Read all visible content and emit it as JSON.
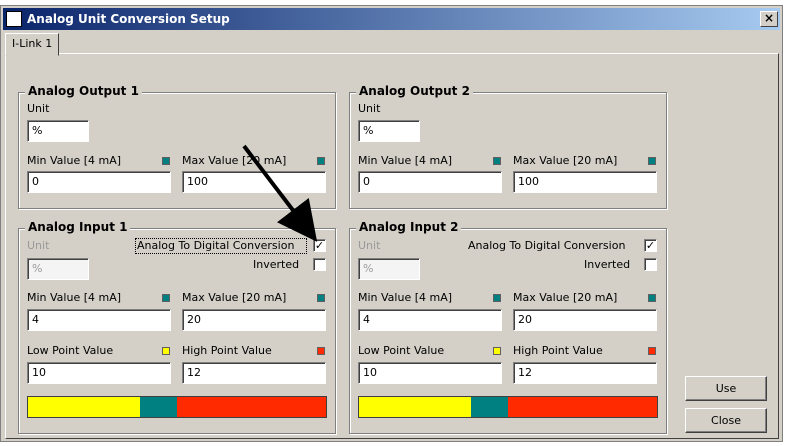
{
  "window": {
    "title": "Analog Unit Conversion Setup",
    "close_glyph": "×"
  },
  "tabs": [
    {
      "label": "I-Link 1"
    }
  ],
  "colors": {
    "low_led": "#ffff00",
    "mid_led": "#008080",
    "high_led": "#ff2a00",
    "title_gradient_start": "#0a246a"
  },
  "outputs": [
    {
      "title": "Analog Output 1",
      "unit_label": "Unit",
      "unit_value": "%",
      "min_label": "Min Value [4 mA]",
      "min_value": "0",
      "max_label": "Max Value [20 mA]",
      "max_value": "100"
    },
    {
      "title": "Analog Output 2",
      "unit_label": "Unit",
      "unit_value": "%",
      "min_label": "Min Value [4 mA]",
      "min_value": "0",
      "max_label": "Max Value [20 mA]",
      "max_value": "100"
    }
  ],
  "inputs": [
    {
      "title": "Analog Input 1",
      "unit_label": "Unit",
      "unit_value": "%",
      "a2d_label": "Analog To Digital Conversion",
      "a2d_checked": "✓",
      "inverted_label": "Inverted",
      "inverted_checked": "",
      "min_label": "Min Value [4 mA]",
      "min_value": "4",
      "max_label": "Max Value [20 mA]",
      "max_value": "20",
      "low_label": "Low Point Value",
      "low_value": "10",
      "high_label": "High Point Value",
      "high_value": "12"
    },
    {
      "title": "Analog Input 2",
      "unit_label": "Unit",
      "unit_value": "%",
      "a2d_label": "Analog To Digital Conversion",
      "a2d_checked": "✓",
      "inverted_label": "Inverted",
      "inverted_checked": "",
      "min_label": "Min Value [4 mA]",
      "min_value": "4",
      "max_label": "Max Value [20 mA]",
      "max_value": "20",
      "low_label": "Low Point Value",
      "low_value": "10",
      "high_label": "High Point Value",
      "high_value": "12"
    }
  ],
  "range_bar": {
    "low_fraction": 0.375,
    "mid_fraction": 0.125,
    "high_fraction": 0.5
  },
  "buttons": {
    "use": "Use",
    "close": "Close"
  }
}
